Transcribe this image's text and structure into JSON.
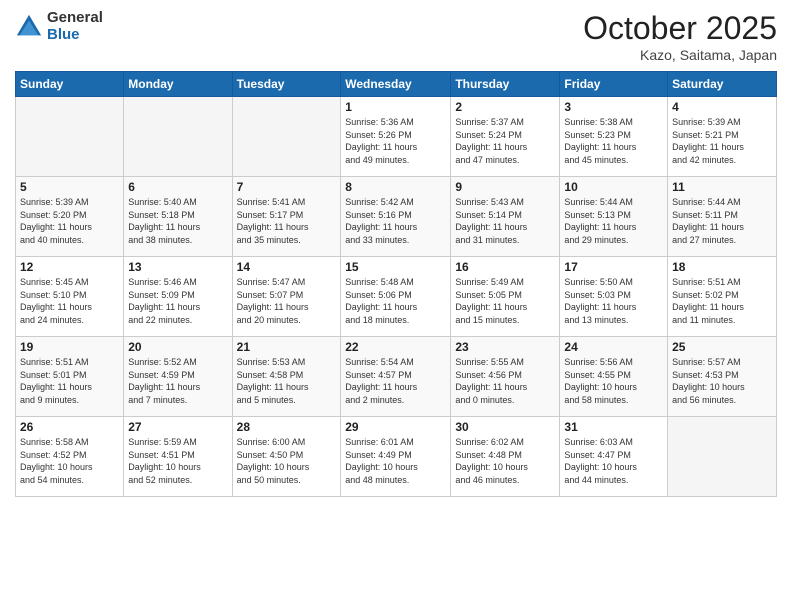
{
  "logo": {
    "general": "General",
    "blue": "Blue"
  },
  "header": {
    "month": "October 2025",
    "location": "Kazo, Saitama, Japan"
  },
  "weekdays": [
    "Sunday",
    "Monday",
    "Tuesday",
    "Wednesday",
    "Thursday",
    "Friday",
    "Saturday"
  ],
  "weeks": [
    [
      {
        "day": "",
        "info": ""
      },
      {
        "day": "",
        "info": ""
      },
      {
        "day": "",
        "info": ""
      },
      {
        "day": "1",
        "info": "Sunrise: 5:36 AM\nSunset: 5:26 PM\nDaylight: 11 hours\nand 49 minutes."
      },
      {
        "day": "2",
        "info": "Sunrise: 5:37 AM\nSunset: 5:24 PM\nDaylight: 11 hours\nand 47 minutes."
      },
      {
        "day": "3",
        "info": "Sunrise: 5:38 AM\nSunset: 5:23 PM\nDaylight: 11 hours\nand 45 minutes."
      },
      {
        "day": "4",
        "info": "Sunrise: 5:39 AM\nSunset: 5:21 PM\nDaylight: 11 hours\nand 42 minutes."
      }
    ],
    [
      {
        "day": "5",
        "info": "Sunrise: 5:39 AM\nSunset: 5:20 PM\nDaylight: 11 hours\nand 40 minutes."
      },
      {
        "day": "6",
        "info": "Sunrise: 5:40 AM\nSunset: 5:18 PM\nDaylight: 11 hours\nand 38 minutes."
      },
      {
        "day": "7",
        "info": "Sunrise: 5:41 AM\nSunset: 5:17 PM\nDaylight: 11 hours\nand 35 minutes."
      },
      {
        "day": "8",
        "info": "Sunrise: 5:42 AM\nSunset: 5:16 PM\nDaylight: 11 hours\nand 33 minutes."
      },
      {
        "day": "9",
        "info": "Sunrise: 5:43 AM\nSunset: 5:14 PM\nDaylight: 11 hours\nand 31 minutes."
      },
      {
        "day": "10",
        "info": "Sunrise: 5:44 AM\nSunset: 5:13 PM\nDaylight: 11 hours\nand 29 minutes."
      },
      {
        "day": "11",
        "info": "Sunrise: 5:44 AM\nSunset: 5:11 PM\nDaylight: 11 hours\nand 27 minutes."
      }
    ],
    [
      {
        "day": "12",
        "info": "Sunrise: 5:45 AM\nSunset: 5:10 PM\nDaylight: 11 hours\nand 24 minutes."
      },
      {
        "day": "13",
        "info": "Sunrise: 5:46 AM\nSunset: 5:09 PM\nDaylight: 11 hours\nand 22 minutes."
      },
      {
        "day": "14",
        "info": "Sunrise: 5:47 AM\nSunset: 5:07 PM\nDaylight: 11 hours\nand 20 minutes."
      },
      {
        "day": "15",
        "info": "Sunrise: 5:48 AM\nSunset: 5:06 PM\nDaylight: 11 hours\nand 18 minutes."
      },
      {
        "day": "16",
        "info": "Sunrise: 5:49 AM\nSunset: 5:05 PM\nDaylight: 11 hours\nand 15 minutes."
      },
      {
        "day": "17",
        "info": "Sunrise: 5:50 AM\nSunset: 5:03 PM\nDaylight: 11 hours\nand 13 minutes."
      },
      {
        "day": "18",
        "info": "Sunrise: 5:51 AM\nSunset: 5:02 PM\nDaylight: 11 hours\nand 11 minutes."
      }
    ],
    [
      {
        "day": "19",
        "info": "Sunrise: 5:51 AM\nSunset: 5:01 PM\nDaylight: 11 hours\nand 9 minutes."
      },
      {
        "day": "20",
        "info": "Sunrise: 5:52 AM\nSunset: 4:59 PM\nDaylight: 11 hours\nand 7 minutes."
      },
      {
        "day": "21",
        "info": "Sunrise: 5:53 AM\nSunset: 4:58 PM\nDaylight: 11 hours\nand 5 minutes."
      },
      {
        "day": "22",
        "info": "Sunrise: 5:54 AM\nSunset: 4:57 PM\nDaylight: 11 hours\nand 2 minutes."
      },
      {
        "day": "23",
        "info": "Sunrise: 5:55 AM\nSunset: 4:56 PM\nDaylight: 11 hours\nand 0 minutes."
      },
      {
        "day": "24",
        "info": "Sunrise: 5:56 AM\nSunset: 4:55 PM\nDaylight: 10 hours\nand 58 minutes."
      },
      {
        "day": "25",
        "info": "Sunrise: 5:57 AM\nSunset: 4:53 PM\nDaylight: 10 hours\nand 56 minutes."
      }
    ],
    [
      {
        "day": "26",
        "info": "Sunrise: 5:58 AM\nSunset: 4:52 PM\nDaylight: 10 hours\nand 54 minutes."
      },
      {
        "day": "27",
        "info": "Sunrise: 5:59 AM\nSunset: 4:51 PM\nDaylight: 10 hours\nand 52 minutes."
      },
      {
        "day": "28",
        "info": "Sunrise: 6:00 AM\nSunset: 4:50 PM\nDaylight: 10 hours\nand 50 minutes."
      },
      {
        "day": "29",
        "info": "Sunrise: 6:01 AM\nSunset: 4:49 PM\nDaylight: 10 hours\nand 48 minutes."
      },
      {
        "day": "30",
        "info": "Sunrise: 6:02 AM\nSunset: 4:48 PM\nDaylight: 10 hours\nand 46 minutes."
      },
      {
        "day": "31",
        "info": "Sunrise: 6:03 AM\nSunset: 4:47 PM\nDaylight: 10 hours\nand 44 minutes."
      },
      {
        "day": "",
        "info": ""
      }
    ]
  ]
}
